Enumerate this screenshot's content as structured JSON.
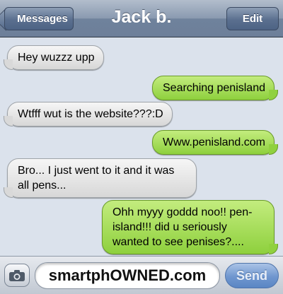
{
  "header": {
    "title": "Jack b.",
    "back_label": "Messages",
    "edit_label": "Edit"
  },
  "messages": [
    {
      "direction": "incoming",
      "text": "Hey wuzzz upp"
    },
    {
      "direction": "outgoing",
      "text": "Searching penisland"
    },
    {
      "direction": "incoming",
      "text": "Wtfff wut is the website???:D"
    },
    {
      "direction": "outgoing",
      "text": "Www.penisland.com"
    },
    {
      "direction": "incoming",
      "text": "Bro... I just went to it and it was all pens..."
    },
    {
      "direction": "outgoing",
      "text": "Ohh myyy goddd noo!! pen-island!!! did u seriously wanted to see penises?...."
    }
  ],
  "composer": {
    "camera_icon": "camera-icon",
    "field_value": "smartphOWNED.com",
    "send_label": "Send"
  },
  "colors": {
    "incoming_bubble": "#e6e6e6",
    "outgoing_bubble": "#a6de5c",
    "navbar": "#7d8fa8",
    "background": "#dbe2ec",
    "send_button": "#6f96cf"
  }
}
